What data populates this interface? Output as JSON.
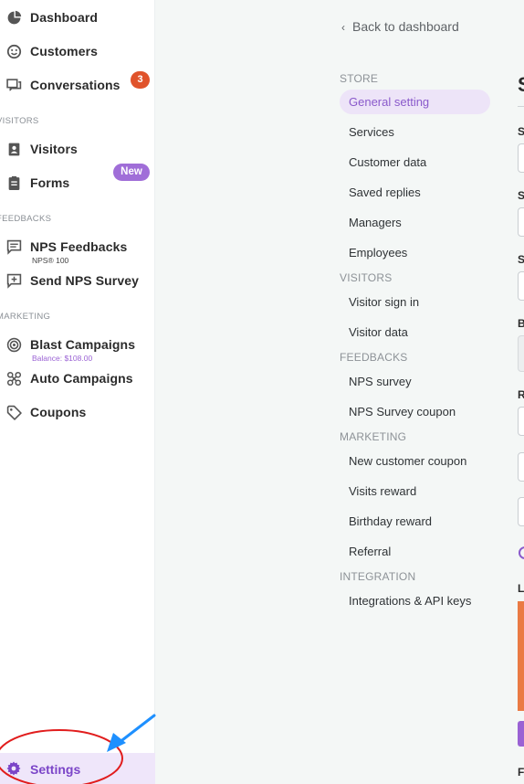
{
  "sidebar": {
    "items": [
      {
        "label": "Dashboard",
        "icon": "dashboard-pie-icon"
      },
      {
        "label": "Customers",
        "icon": "smiley-face-icon"
      },
      {
        "label": "Conversations",
        "icon": "chat-bubbles-icon",
        "badge": "3"
      },
      {
        "label": "Visitors",
        "icon": "id-badge-icon"
      },
      {
        "label": "Forms",
        "icon": "form-clipboard-icon",
        "badge": "New"
      },
      {
        "label": "NPS Feedbacks",
        "icon": "feedback-message-icon",
        "sublabel": "NPS® 100"
      },
      {
        "label": "Send NPS Survey",
        "icon": "send-survey-icon"
      },
      {
        "label": "Blast Campaigns",
        "icon": "target-icon",
        "sublabel": "Balance: $108.00"
      },
      {
        "label": "Auto Campaigns",
        "icon": "automation-icon"
      },
      {
        "label": "Coupons",
        "icon": "tag-icon"
      }
    ],
    "sections": {
      "visitors": "VISITORS",
      "feedbacks": "FEEDBACKS",
      "marketing": "MARKETING"
    },
    "settings": {
      "label": "Settings",
      "icon": "gear-icon"
    }
  },
  "main": {
    "back_label": "Back to dashboard",
    "settings_nav": {
      "sections": [
        "STORE",
        "VISITORS",
        "FEEDBACKS",
        "MARKETING",
        "INTEGRATION"
      ],
      "items": [
        "General setting",
        "Services",
        "Customer data",
        "Saved replies",
        "Managers",
        "Employees",
        "Visitor sign in",
        "Visitor data",
        "NPS survey",
        "NPS Survey coupon",
        "New customer coupon",
        "Visits reward",
        "Birthday reward",
        "Referral",
        "Integrations & API keys"
      ],
      "active_item": "General setting"
    },
    "panel": {
      "title_fragment": "S",
      "labels": [
        "S",
        "S",
        "S",
        "B",
        "R",
        "L",
        "F"
      ]
    }
  },
  "colors": {
    "accent_purple": "#8a5acb",
    "badge_orange": "#e0532b",
    "badge_purple": "#a06ed8",
    "annotation_red": "#e11d1d",
    "annotation_blue": "#1e90ff"
  }
}
